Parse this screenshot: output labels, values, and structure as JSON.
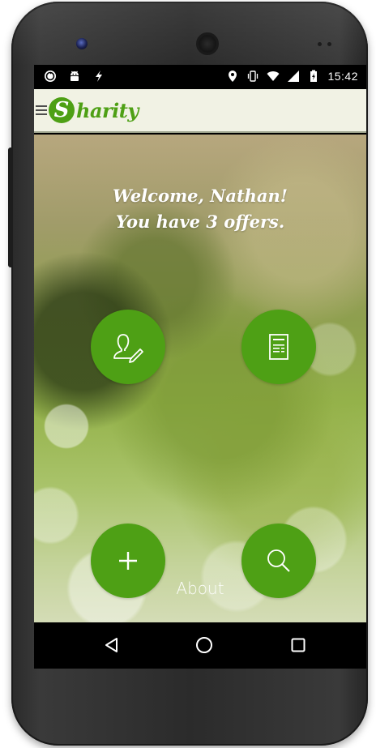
{
  "status_bar": {
    "time": "15:42",
    "left_icons": [
      "sync-icon",
      "android-icon",
      "flash-icon"
    ],
    "right_icons": [
      "location-icon",
      "vibrate-icon",
      "wifi-icon",
      "signal-icon",
      "battery-icon"
    ]
  },
  "app_bar": {
    "logo_letter": "S",
    "logo_text": "harity",
    "brand_color": "#4ea015"
  },
  "main": {
    "welcome_line1": "Welcome, Nathan!",
    "welcome_line2": "You have 3 offers.",
    "buttons": [
      {
        "icon": "edit-profile-icon"
      },
      {
        "icon": "document-list-icon"
      },
      {
        "icon": "plus-icon"
      },
      {
        "icon": "search-icon"
      }
    ],
    "about_label": "About"
  },
  "nav_bar": {
    "icons": [
      "back-icon",
      "home-icon",
      "recents-icon"
    ]
  }
}
